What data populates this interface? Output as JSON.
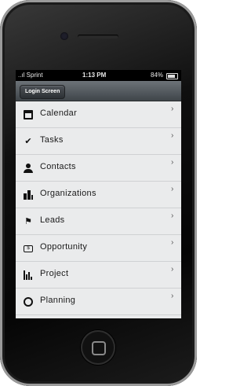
{
  "status_bar": {
    "carrier": "..ıl Sprint",
    "time": "1:13 PM",
    "battery": "84%"
  },
  "navbar": {
    "back_label": "Login Screen"
  },
  "menu": {
    "items": [
      {
        "label": "Calendar",
        "icon": "calendar-icon"
      },
      {
        "label": "Tasks",
        "icon": "checkmark-icon"
      },
      {
        "label": "Contacts",
        "icon": "person-icon"
      },
      {
        "label": "Organizations",
        "icon": "building-icon"
      },
      {
        "label": "Leads",
        "icon": "flag-icon"
      },
      {
        "label": "Opportunity",
        "icon": "money-icon"
      },
      {
        "label": "Project",
        "icon": "bar-chart-icon"
      },
      {
        "label": "Planning",
        "icon": "circle-icon"
      }
    ]
  }
}
